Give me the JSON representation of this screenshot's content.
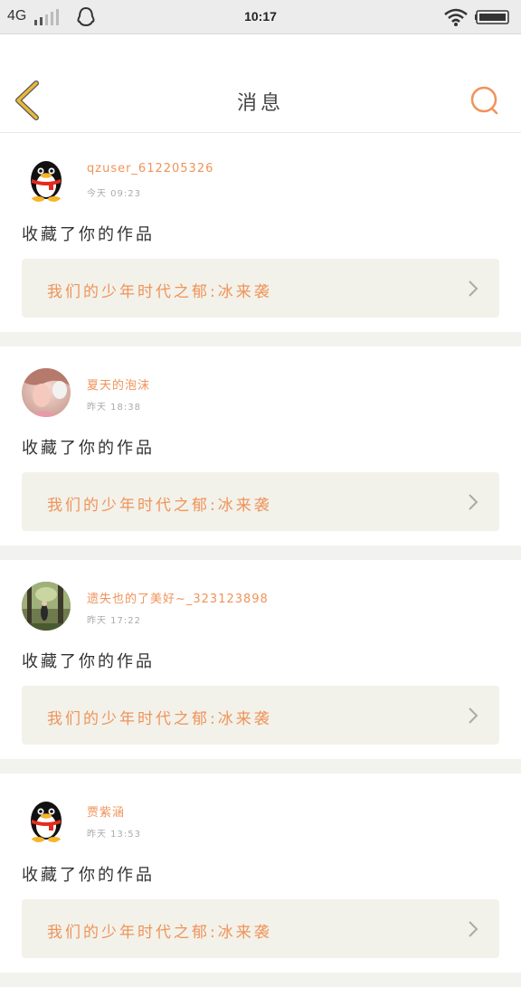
{
  "status_bar": {
    "network": "4G",
    "time": "10:17",
    "icons": [
      "signal-icon",
      "qq-icon",
      "wifi-icon",
      "battery-icon"
    ]
  },
  "header": {
    "title": "消息",
    "back_icon": "chevron-left-icon",
    "search_icon": "search-icon"
  },
  "colors": {
    "accent": "#f0935a",
    "back_arrow": "#e8b93a",
    "link_bg": "#f2f2ea",
    "separator": "#f2f2ef"
  },
  "messages": [
    {
      "username": "qzuser_612205326",
      "timestamp": "今天 09:23",
      "action": "收藏了你的作品",
      "work_title": "我们的少年时代之郁:冰来袭",
      "avatar": "qq-penguin-avatar"
    },
    {
      "username": "夏天的泡沫",
      "timestamp": "昨天 18:38",
      "action": "收藏了你的作品",
      "work_title": "我们的少年时代之郁:冰来袭",
      "avatar": "photo-avatar-girl"
    },
    {
      "username": "遗失也的了美好~_323123898",
      "timestamp": "昨天 17:22",
      "action": "收藏了你的作品",
      "work_title": "我们的少年时代之郁:冰来袭",
      "avatar": "photo-avatar-forest"
    },
    {
      "username": "贾紫涵",
      "timestamp": "昨天 13:53",
      "action": "收藏了你的作品",
      "work_title": "我们的少年时代之郁:冰来袭",
      "avatar": "qq-penguin-avatar"
    }
  ]
}
